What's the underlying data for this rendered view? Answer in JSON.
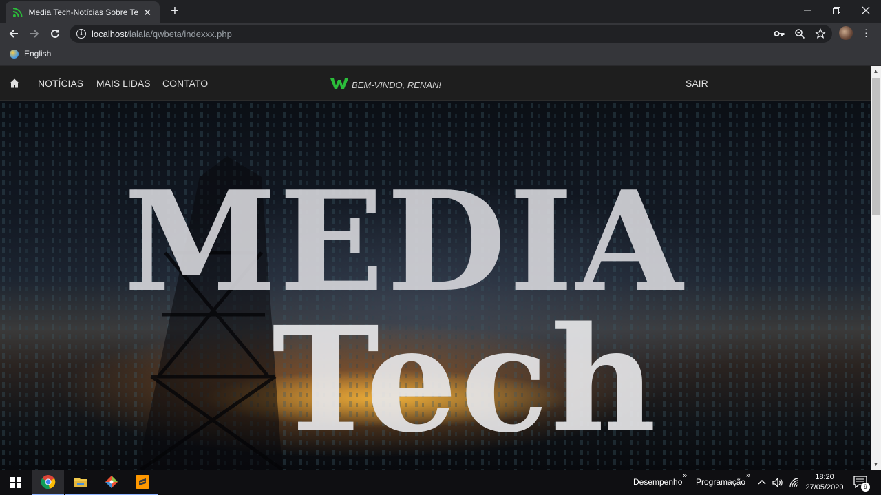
{
  "browser": {
    "tab_title": "Media Tech-Notícias Sobre Tecnologia",
    "new_tab_symbol": "+",
    "url_host": "localhost",
    "url_path": "/lalala/qwbeta/indexxx.php",
    "bookmark_label": "English"
  },
  "site": {
    "nav_links": [
      "NOTÍCIAS",
      "MAIS LIDAS",
      "CONTATO"
    ],
    "welcome_text": "BEM-VINDO, RENAN!",
    "logout_label": "SAIR",
    "accent_color": "#2bbd3a",
    "hero_logo_line1": "MEDIA",
    "hero_logo_line2": "Tech"
  },
  "taskbar": {
    "toolbar1": "Desempenho",
    "toolbar2": "Programação",
    "time": "18:20",
    "date": "27/05/2020",
    "notifications": "9"
  }
}
